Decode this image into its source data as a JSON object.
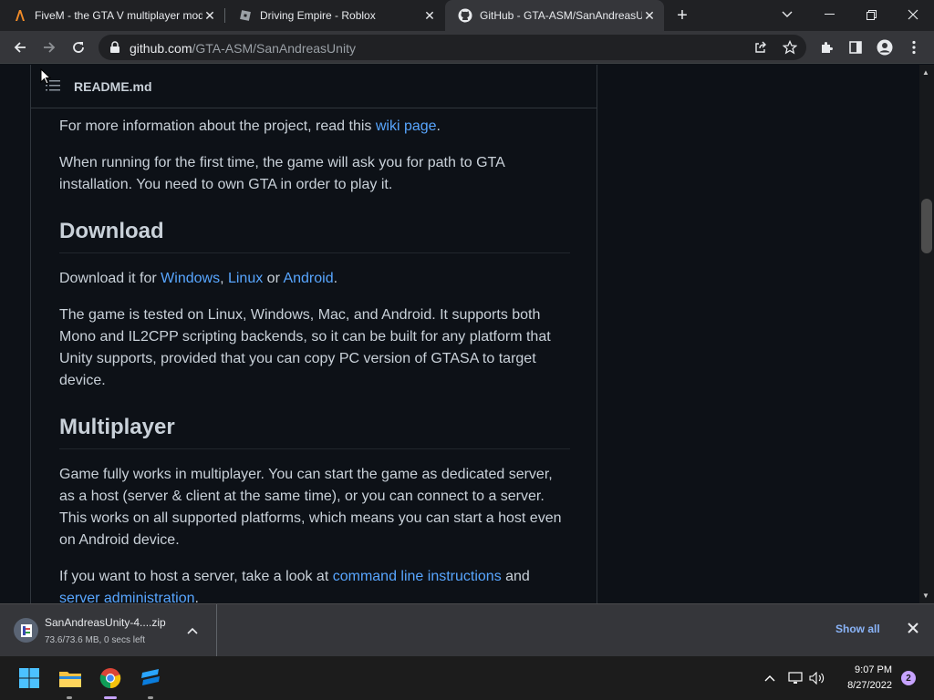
{
  "browser": {
    "tabs": [
      {
        "title": "FiveM - the GTA V multiplayer mod",
        "favicon": "fivem-icon",
        "active": false
      },
      {
        "title": "Driving Empire - Roblox",
        "favicon": "roblox-icon",
        "active": false
      },
      {
        "title": "GitHub - GTA-ASM/SanAndreasUnity",
        "favicon": "github-icon",
        "active": true
      }
    ],
    "address": {
      "host": "github.com",
      "path": "/GTA-ASM/SanAndreasUnity"
    }
  },
  "readme": {
    "filename": "README.md",
    "intro": {
      "text_before": "For more information about the project, read this ",
      "link": "wiki page",
      "text_after": "."
    },
    "first_run": "When running for the first time, the game will ask you for path to GTA installation. You need to own GTA in order to play it.",
    "download": {
      "heading": "Download",
      "prefix": "Download it for ",
      "windows": "Windows",
      "sep1": ", ",
      "linux": "Linux",
      "sep2": " or ",
      "android": "Android",
      "suffix": ".",
      "tested": "The game is tested on Linux, Windows, Mac, and Android. It supports both Mono and IL2CPP scripting backends, so it can be built for any platform that Unity supports, provided that you can copy PC version of GTASA to target device."
    },
    "multiplayer": {
      "heading": "Multiplayer",
      "body": "Game fully works in multiplayer. You can start the game as dedicated server, as a host (server & client at the same time), or you can connect to a server. This works on all supported platforms, which means you can start a host even on Android device.",
      "host_prefix": "If you want to host a server, take a look at ",
      "cmd_link": "command line instructions",
      "and": " and ",
      "admin_link": "server administration",
      "host_suffix": "."
    }
  },
  "download_shelf": {
    "file_name": "SanAndreasUnity-4....zip",
    "status": "73.6/73.6 MB, 0 secs left",
    "show_all": "Show all"
  },
  "taskbar": {
    "time": "9:07 PM",
    "date": "8/27/2022",
    "notifications": "2"
  }
}
